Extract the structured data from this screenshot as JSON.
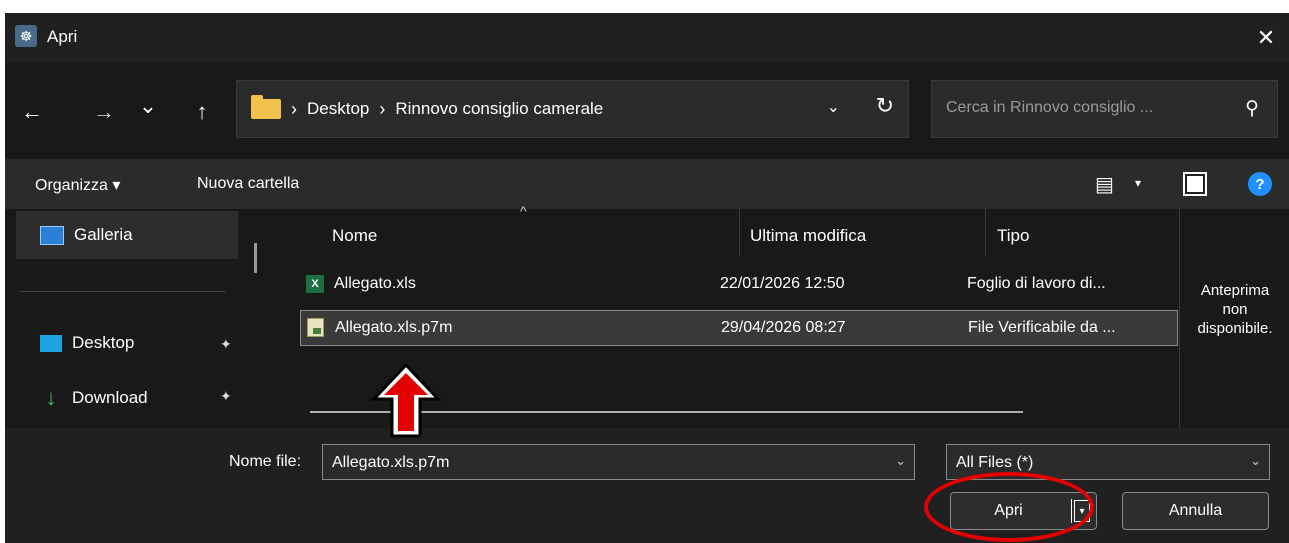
{
  "window": {
    "title": "Apri",
    "close_glyph": "✕"
  },
  "nav": {
    "back": "←",
    "forward": "→",
    "recent": "⌄",
    "up": "↑"
  },
  "address": {
    "crumbs": [
      "Desktop",
      "Rinnovo consiglio camerale"
    ],
    "separator": "›",
    "dropdown": "⌄",
    "refresh": "↻"
  },
  "search": {
    "placeholder": "Cerca in Rinnovo consiglio ...",
    "icon": "⚲"
  },
  "toolbar": {
    "organize_label": "Organizza ▾",
    "new_folder_label": "Nuova cartella",
    "view_icon": "▤",
    "view_drop": "▾",
    "help": "?"
  },
  "sidebar": {
    "items": [
      {
        "label": "Galleria",
        "pinned": false
      },
      {
        "label": "Desktop",
        "pinned": true
      },
      {
        "label": "Download",
        "pinned": true
      }
    ],
    "pin_glyph": "✦",
    "download_glyph": "↓"
  },
  "filelist": {
    "columns": [
      "Nome",
      "Ultima modifica",
      "Tipo"
    ],
    "sort_glyph": "^",
    "rows": [
      {
        "name": "Allegato.xls",
        "modified": "22/01/2026 12:50",
        "type": "Foglio di lavoro di...",
        "icon": "excel-file-icon",
        "selected": false
      },
      {
        "name": "Allegato.xls.p7m",
        "modified": "29/04/2026 08:27",
        "type": "File Verificabile da ...",
        "icon": "signed-file-icon",
        "selected": true
      }
    ]
  },
  "preview": {
    "text": "Anteprima\nnon\ndisponibile."
  },
  "footer": {
    "filename_label": "Nome file:",
    "filename_value": "Allegato.xls.p7m",
    "filetype_value": "All Files  (*)",
    "open_label": "Apri",
    "cancel_label": "Annulla",
    "dropdown_glyph": "⌄",
    "split_glyph": "▾"
  },
  "annotations": {
    "arrow_color": "#e30000",
    "ellipse_color": "#e30000"
  }
}
